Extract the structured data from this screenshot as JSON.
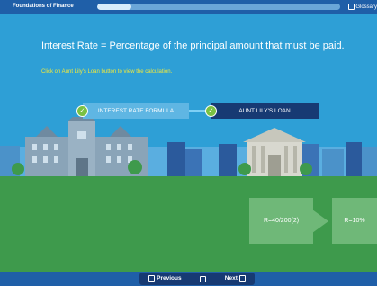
{
  "topbar": {
    "course_title": "Foundations of Finance",
    "progress_fraction": 0.14,
    "glossary_label": "Glossary"
  },
  "content": {
    "headline": "Interest Rate = Percentage of the principal amount that must be paid.",
    "instruction": "Click on Aunt Lily's Loan button to view the calculation.",
    "steps": [
      {
        "label": "INTEREST RATE FORMULA",
        "completed": true
      },
      {
        "label": "AUNT LILY'S LOAN",
        "completed": true
      }
    ],
    "calculation": {
      "formula": "R=40/200(2)",
      "result": "R=10%"
    }
  },
  "navigation": {
    "previous_label": "Previous",
    "next_label": "Next"
  },
  "icons": {
    "check": "check-icon",
    "prev": "square-icon",
    "next": "square-icon"
  },
  "colors": {
    "sky": "#2e9fd6",
    "bar": "#1f5fa8",
    "grass": "#3e9a4c",
    "accent_yellow": "#f2e93b",
    "check_green": "#7ac143"
  }
}
